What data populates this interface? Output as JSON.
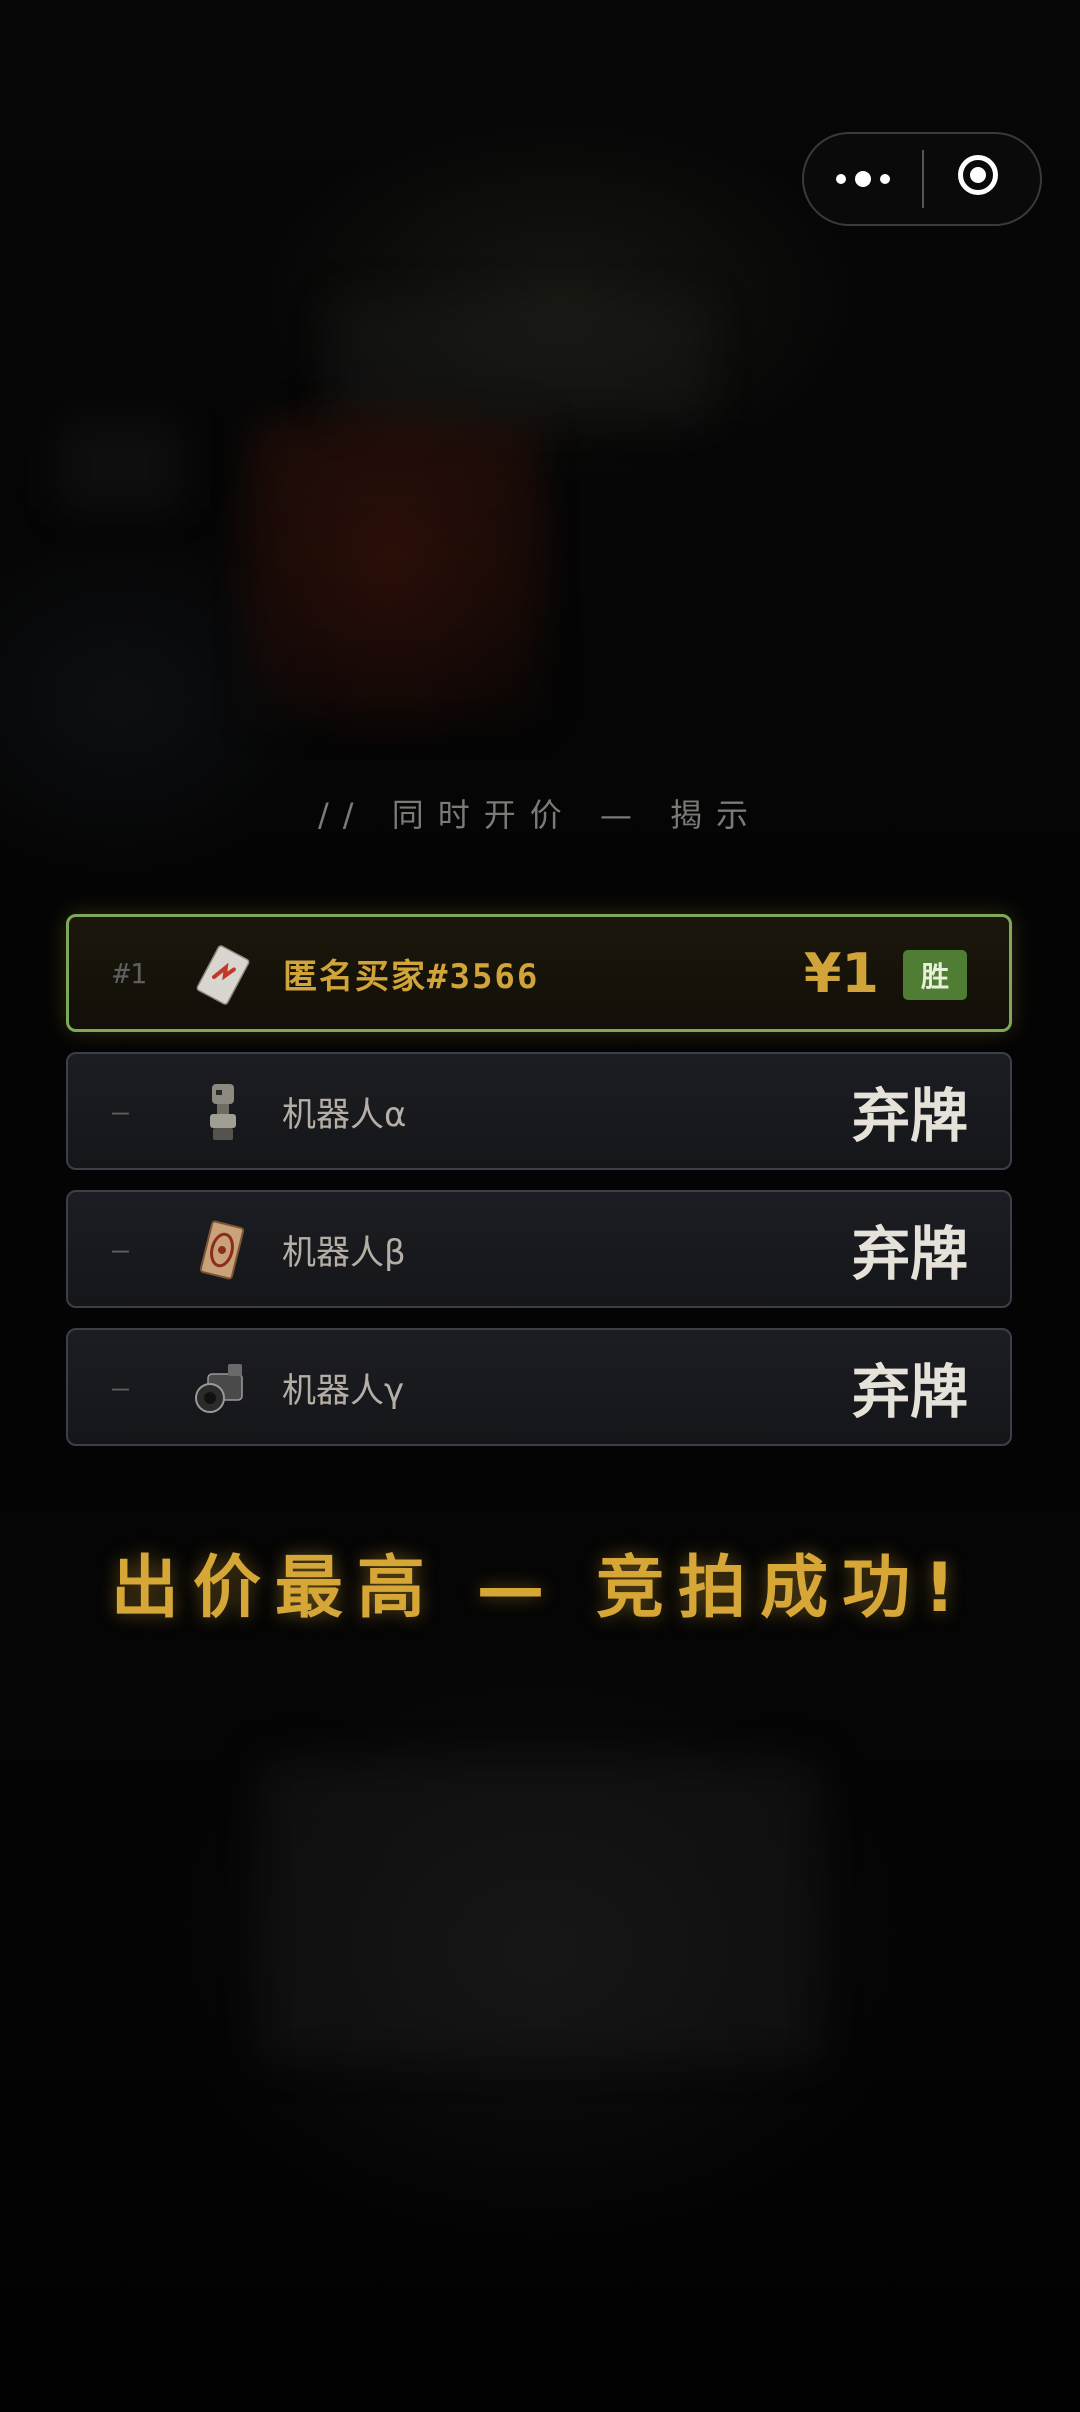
{
  "capsule": {
    "more_icon": "more-dots-icon",
    "close_icon": "target-ring-icon"
  },
  "reveal_header": "// 同时开价 — 揭示",
  "bids": [
    {
      "rank": "#1",
      "name": "匿名买家#3566",
      "price": "¥1",
      "badge": "胜",
      "avatar_icon": "card-icon",
      "status": "winner"
    },
    {
      "rank": "—",
      "name": "机器人α",
      "result": "弃牌",
      "avatar_icon": "robot-statue-icon",
      "status": "folded"
    },
    {
      "rank": "—",
      "name": "机器人β",
      "result": "弃牌",
      "avatar_icon": "ornate-card-icon",
      "status": "folded"
    },
    {
      "rank": "—",
      "name": "机器人γ",
      "result": "弃牌",
      "avatar_icon": "camera-icon",
      "status": "folded"
    }
  ],
  "result_banner": "出价最高 — 竞拍成功!",
  "colors": {
    "gold": "#d1a43a",
    "winner_border": "#7ea95a",
    "badge_green": "#4f7d33",
    "row_border": "#3c3f4a",
    "muted_text": "#7c7a76"
  }
}
